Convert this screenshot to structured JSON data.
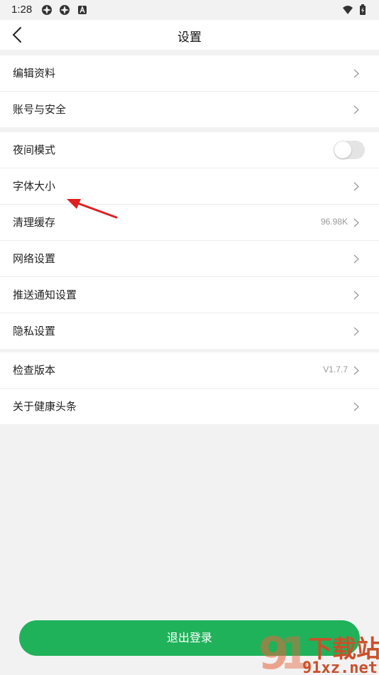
{
  "status_bar": {
    "time": "1:28"
  },
  "header": {
    "title": "设置"
  },
  "group1": [
    {
      "label": "编辑资料"
    },
    {
      "label": "账号与安全"
    }
  ],
  "group2": [
    {
      "label": "夜间模式"
    },
    {
      "label": "字体大小"
    },
    {
      "label": "清理缓存",
      "value": "96.98K"
    },
    {
      "label": "网络设置"
    },
    {
      "label": "推送通知设置"
    },
    {
      "label": "隐私设置"
    }
  ],
  "group3": [
    {
      "label": "检查版本",
      "value": "V1.7.7"
    },
    {
      "label": "关于健康头条"
    }
  ],
  "night_mode_enabled": false,
  "logout_label": "退出登录",
  "watermark": {
    "site": "91xz.net",
    "brand": "下载站"
  },
  "colors": {
    "accent": "#1fb25a",
    "background": "#f2f2f2",
    "annotation": "#e02020"
  },
  "icons": [
    "back-arrow-icon",
    "chevron-right-icon",
    "wifi-icon",
    "battery-icon",
    "notification-icon"
  ]
}
